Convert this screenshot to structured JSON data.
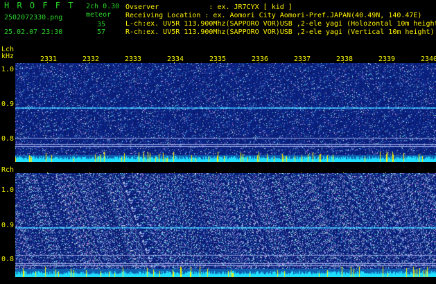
{
  "header": {
    "app_name": "H R O F F T",
    "filename": "2502072330.png",
    "datetime": "25.02.07 23:30",
    "channel_info": "2ch 0.30",
    "meteor_label": "meteor",
    "lch_count": "35",
    "rch_count": "57",
    "observer_line": "Ovserver            : ex. JR7CYX [ kid ]",
    "location_line": "Receiving Location : ex. Aomori City Aomori-Pref.JAPAN(40.49N, 140.47E)",
    "lch_line": "L-ch:ex. UV5R 113.900Mhz(SAPPORO VOR)USB ,2-ele yagi (Holozontal 10m height)",
    "rch_line": "R-ch:ex. UV5R 113.900Mhz(SAPPORO VOR)USB ,2-ele yagi (Vertical 10m height)"
  },
  "time_axis": [
    "2331",
    "2332",
    "2333",
    "2334",
    "2335",
    "2336",
    "2337",
    "2338",
    "2339",
    "2340"
  ],
  "lch_panel": {
    "label": "Lch",
    "unit": "kHz",
    "ticks": [
      "1.0",
      "0.9",
      "0.8"
    ]
  },
  "rch_panel": {
    "label": "Rch",
    "ticks": [
      "1.0",
      "0.9",
      "0.8"
    ]
  },
  "colors": {
    "background": "#000000",
    "header_green": "#2bd62b",
    "axis_yellow": "#f4f400",
    "spectrum_blue": "#1a2a8a",
    "activity_cyan": "#20e0ff",
    "activity_yellow": "#fff200"
  }
}
